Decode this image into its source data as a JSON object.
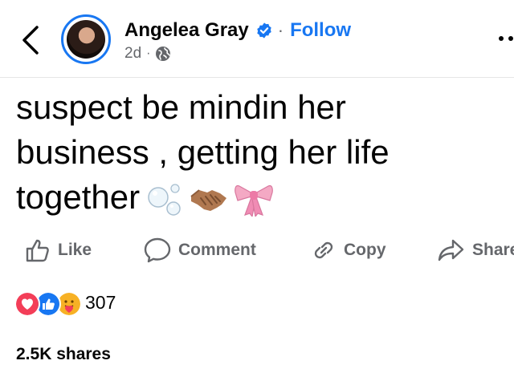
{
  "post": {
    "author": {
      "name": "Angelea Gray",
      "verified": true
    },
    "follow_label": "Follow",
    "separator": "·",
    "time": "2d",
    "meta_separator": "·",
    "audience_icon": "globe-icon",
    "text_lines": [
      "suspect be mindin her",
      "business , getting her life",
      "together"
    ],
    "emojis": [
      "bubbles-emoji",
      "handshake-emoji",
      "ribbon-bow-emoji"
    ]
  },
  "actions": {
    "like": "Like",
    "comment": "Comment",
    "copy": "Copy",
    "share": "Share"
  },
  "reactions": {
    "icons": [
      "love-icon",
      "like-icon",
      "care-icon"
    ],
    "count": "307"
  },
  "shares": "2.5K shares",
  "colors": {
    "accent": "#1877f2",
    "secondary_text": "#65676b",
    "love": "#f33e58",
    "care": "#f7b125"
  }
}
